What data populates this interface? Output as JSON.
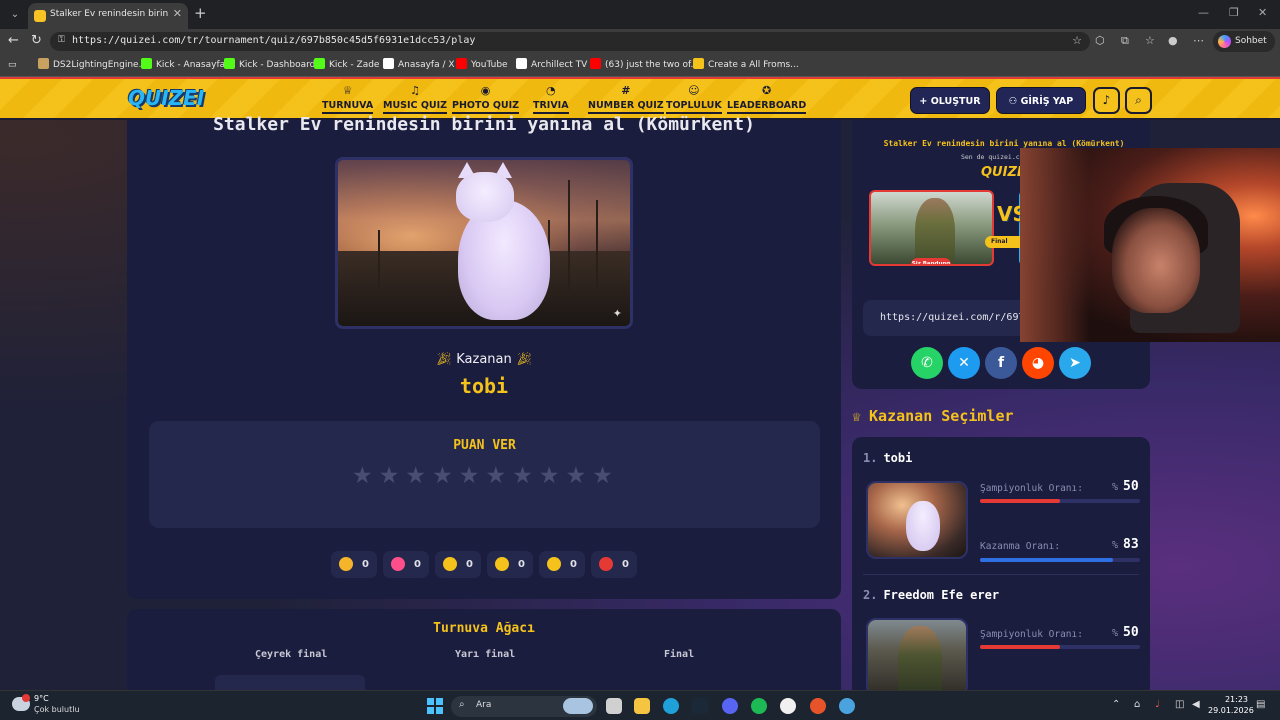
{
  "browser": {
    "tab_title": "Stalker Ev renindesin birini yanına al (Kömürkent) - Quizei",
    "url": "https://quizei.com/tr/tournament/quiz/697b850c45d5f6931e1dcc53/play",
    "copilot_label": "Sohbet et",
    "bookmarks": [
      {
        "label": "DS2LightingEngine...",
        "color": "#c8a060"
      },
      {
        "label": "Kick - Anasayfa",
        "color": "#53fc18"
      },
      {
        "label": "Kick - Dashboard",
        "color": "#53fc18"
      },
      {
        "label": "Kick - Zade",
        "color": "#53fc18"
      },
      {
        "label": "Anasayfa / X",
        "color": "#ffffff"
      },
      {
        "label": "YouTube",
        "color": "#ff0000"
      },
      {
        "label": "Archillect TV",
        "color": "#ffffff"
      },
      {
        "label": "(63) just the two of...",
        "color": "#ff0000"
      },
      {
        "label": "Create a All Froms...",
        "color": "#f5c21b"
      }
    ]
  },
  "site": {
    "logo": "QUIZEI",
    "nav": [
      {
        "label": "TURNUVA",
        "icon": "trophy-icon",
        "glyph": "♕"
      },
      {
        "label": "MUSIC QUIZ",
        "icon": "music-icon",
        "glyph": "♫"
      },
      {
        "label": "PHOTO QUIZ",
        "icon": "camera-icon",
        "glyph": "◉"
      },
      {
        "label": "TRIVIA",
        "icon": "chat-icon",
        "glyph": "◔"
      },
      {
        "label": "NUMBER QUIZ",
        "icon": "hash-icon",
        "glyph": "#"
      },
      {
        "label": "TOPLULUK",
        "icon": "users-icon",
        "glyph": "☺"
      },
      {
        "label": "LEADERBOARD",
        "icon": "medal-icon",
        "glyph": "✪"
      }
    ],
    "create_label": "OLUŞTUR",
    "login_label": "GİRİŞ YAP",
    "accent": "#f5c21b"
  },
  "quiz": {
    "title": "Stalker Ev renindesin birini yanına al (Kömürkent)",
    "winner_label": "Kazanan",
    "winner_name": "tobi",
    "rate_title": "PUAN VER",
    "star_count": 10,
    "reactions": [
      {
        "icon": "thumbs-up-icon",
        "count": "0",
        "color": "#f5b52a"
      },
      {
        "icon": "heart-icon",
        "count": "0",
        "color": "#ff4f8b"
      },
      {
        "icon": "laugh-icon",
        "count": "0",
        "color": "#f5c21b"
      },
      {
        "icon": "wow-icon",
        "count": "0",
        "color": "#f5c21b"
      },
      {
        "icon": "sad-icon",
        "count": "0",
        "color": "#f5c21b"
      },
      {
        "icon": "angry-icon",
        "count": "0",
        "color": "#e53935"
      }
    ]
  },
  "bracket": {
    "title": "Turnuva Ağacı",
    "rounds": [
      "Çeyrek final",
      "Yarı final",
      "Final"
    ]
  },
  "share": {
    "preview_title": "Stalker Ev renindesin birini yanına al (Kömürkent)",
    "preview_sub": "Sen de quizei.com'da s",
    "preview_badge": "Siz Bandung",
    "preview_final": "Final",
    "preview_vs": "VS",
    "url": "https://quizei.com/r/697b"
  },
  "picks": {
    "title": "Kazanan Seçimler",
    "items": [
      {
        "rank": "1.",
        "name": "tobi",
        "champ_label": "Şampiyonluk Oranı:",
        "champ_value": "50",
        "win_label": "Kazanma Oranı:",
        "win_value": "83",
        "champ_pct": 50,
        "win_pct": 83
      },
      {
        "rank": "2.",
        "name": "Freedom Efe erer",
        "champ_label": "Şampiyonluk Oranı:",
        "champ_value": "50",
        "champ_pct": 50
      }
    ]
  },
  "taskbar": {
    "temp": "9°C",
    "weather": "Çok bulutlu",
    "search": "Ara",
    "time": "21:23",
    "date": "29.01.2026"
  }
}
